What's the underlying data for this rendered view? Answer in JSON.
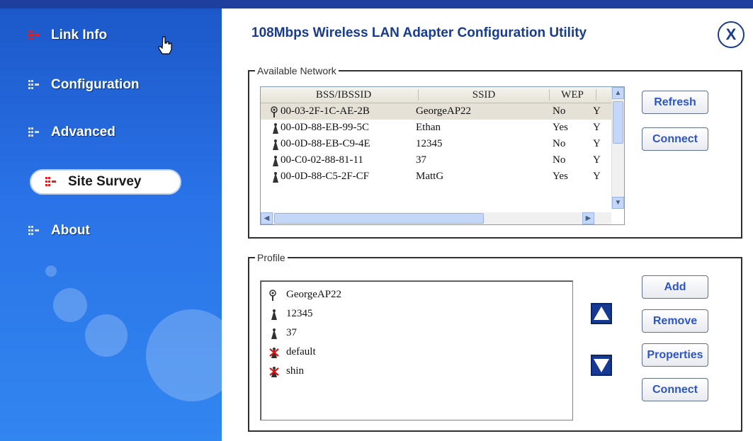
{
  "sidebar": {
    "items": [
      {
        "label": "Link Info",
        "icon": "bar-bullet-icon"
      },
      {
        "label": "Configuration",
        "icon": "bar-bullet-icon"
      },
      {
        "label": "Advanced",
        "icon": "bar-bullet-icon"
      },
      {
        "label": "Site Survey",
        "icon": "bar-bullet-icon"
      },
      {
        "label": "About",
        "icon": "bar-bullet-icon"
      }
    ],
    "active": "Site Survey"
  },
  "header": {
    "title": "108Mbps Wireless LAN Adapter Configuration Utility",
    "close_label": "X"
  },
  "available_network": {
    "legend": "Available Network",
    "columns": [
      "BSS/IBSSID",
      "SSID",
      "WEP"
    ],
    "rows": [
      {
        "bssid": "00-03-2F-1C-AE-2B",
        "ssid": "GeorgeAP22",
        "wep": "No",
        "extra": "Y",
        "icon": "access-point-icon",
        "selected": true
      },
      {
        "bssid": "00-0D-88-EB-99-5C",
        "ssid": "Ethan",
        "wep": "Yes",
        "extra": "Y",
        "icon": "adhoc-station-icon",
        "selected": false
      },
      {
        "bssid": "00-0D-88-EB-C9-4E",
        "ssid": "12345",
        "wep": "No",
        "extra": "Y",
        "icon": "adhoc-station-icon",
        "selected": false
      },
      {
        "bssid": "00-C0-02-88-81-11",
        "ssid": "37",
        "wep": "No",
        "extra": "Y",
        "icon": "adhoc-station-icon",
        "selected": false
      },
      {
        "bssid": "00-0D-88-C5-2F-CF",
        "ssid": "MattG",
        "wep": "Yes",
        "extra": "Y",
        "icon": "adhoc-station-icon",
        "selected": false
      }
    ],
    "buttons": {
      "refresh": "Refresh",
      "connect": "Connect"
    }
  },
  "profile": {
    "legend": "Profile",
    "items": [
      {
        "name": "GeorgeAP22",
        "icon": "access-point-icon"
      },
      {
        "name": "12345",
        "icon": "adhoc-station-icon"
      },
      {
        "name": "37",
        "icon": "adhoc-station-icon"
      },
      {
        "name": "default",
        "icon": "unavailable-station-icon"
      },
      {
        "name": "shin",
        "icon": "unavailable-station-icon"
      }
    ],
    "buttons": {
      "add": "Add",
      "remove": "Remove",
      "properties": "Properties",
      "connect": "Connect"
    }
  },
  "colors": {
    "sidebar": "#2a73e8",
    "title": "#173b8f",
    "button_text": "#2b55c8",
    "bullet_active": "#e02020"
  }
}
